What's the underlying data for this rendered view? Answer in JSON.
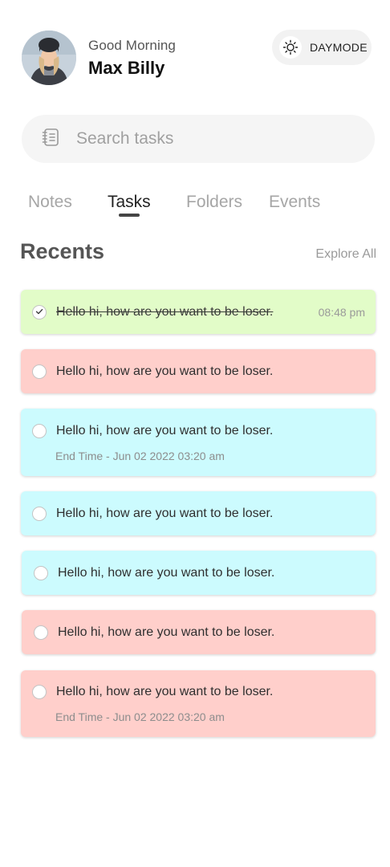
{
  "header": {
    "greeting": "Good Morning",
    "user_name": "Max Billy",
    "mode_label": "DAYMODE"
  },
  "search": {
    "placeholder": "Search tasks",
    "value": ""
  },
  "tabs": [
    {
      "label": "Notes",
      "active": false
    },
    {
      "label": "Tasks",
      "active": true
    },
    {
      "label": "Folders",
      "active": false
    },
    {
      "label": "Events",
      "active": false
    }
  ],
  "recents": {
    "title": "Recents",
    "explore_label": "Explore All",
    "tasks": [
      {
        "text": "Hello hi, how are you want to be loser.",
        "completed": true,
        "time": "08:48 pm",
        "end_time": "",
        "color": "#e2fcc8"
      },
      {
        "text": "Hello hi, how are you want to be loser.",
        "completed": false,
        "time": "",
        "end_time": "",
        "color": "#ffcfcb"
      },
      {
        "text": "Hello hi, how are you want to be loser.",
        "completed": false,
        "time": "",
        "end_time": "End Time - Jun 02 2022 03:20 am",
        "color": "#ccfbfe"
      },
      {
        "text": "Hello hi, how are you want to be loser.",
        "completed": false,
        "time": "",
        "end_time": "",
        "color": "#ccfbfe"
      },
      {
        "text": "Hello hi, how are you want to be loser.",
        "completed": false,
        "time": "",
        "end_time": "",
        "color": "#ccfbfe"
      },
      {
        "text": "Hello hi, how are you want to be loser.",
        "completed": false,
        "time": "",
        "end_time": "",
        "color": "#ffcfcb"
      },
      {
        "text": "Hello hi, how are you want to be loser.",
        "completed": false,
        "time": "",
        "end_time": "End Time - Jun 02 2022 03:20 am",
        "color": "#ffcfcb"
      }
    ]
  },
  "icons": {
    "avatar": "user-avatar",
    "mode": "sun-icon",
    "search": "notebook-icon",
    "check": "check-icon"
  }
}
